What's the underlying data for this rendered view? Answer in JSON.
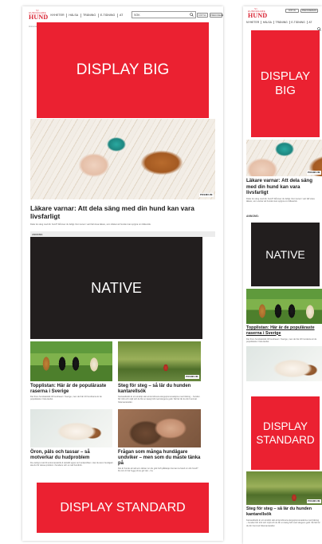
{
  "brand": {
    "small": "VI HUNDÄGARE",
    "big": "HUND"
  },
  "colors": {
    "accent": "#d81e2e",
    "ad_red": "#eb2131",
    "ad_black": "#221e1e"
  },
  "desktop": {
    "nav": [
      "NYHETER",
      "HÄLSA",
      "TRÄNING",
      "E-TIDNING",
      "AT"
    ],
    "search_value": "SÖK",
    "buttons": {
      "subscribe": "KÖP NU",
      "login": "PRENUMERERA"
    },
    "sub_label": "Annons",
    "ad_big": "DISPLAY BIG",
    "main_article": {
      "title": "Läkare varnar: Att dela säng med din hund kan vara livsfarligt",
      "body": "Delar du säng med din hund? Då lever du farligt. Det menar i varit fall vissa läkare, som tidskar att hunden kan sprjpra om lidkesrisk.",
      "badge": "PREMIUM"
    },
    "annons_label": "ANNONS:",
    "ad_native": "NATIVE",
    "grid": [
      {
        "title": "Topplistan: Här är de populäraste raserna i Sverige",
        "body": "Det finns hundstatistik till hundraser i Sverige, men det här 20 hundrarna är de populäraste i hela landet.",
        "badge": ""
      },
      {
        "title": "Steg för steg – så lär du hunden kantarellsök",
        "body": "Kantarellsökt är ett utmärkt sätt att kombinera skogspromenaderna med träning – hunden blir trött och nöjd och du får en kasig fullt med skogens guld. Så här lär du din hund att hitta kantareller.",
        "badge": "PREMIUM"
      },
      {
        "title": "Öron, päls och tassar – så motverkar du hudproblem",
        "body": "De vanligt ut att bli extra kanslorik & särskilt upper av hundproblem. Har du även hundgarn ska du för dessa problem i hundens och en rad hundinfo.",
        "badge": ""
      },
      {
        "title": "Frågan som många hundägare undviker – men som du måste tänka på",
        "body": "Det är hunde att säl som tänker om du gick hoft påktekje inte kan ta hand om din hund? Du tror ör här bygg vili av gör det – ha.",
        "badge": ""
      }
    ],
    "ad_standard": "DISPLAY STANDARD"
  },
  "mobile": {
    "buttons": {
      "subscribe": "KÖP NU",
      "login": "PRENUMERERA"
    },
    "nav": [
      "NYHETER",
      "HÄLSA",
      "TRÄNING",
      "E-TIDNING",
      "AT"
    ],
    "ad_big": "DISPLAY BIG",
    "main_article": {
      "title": "Läkare varnar: Att dela säng med din hund kan vara livsfarligt",
      "body": "Delar du säng med din hund? Då lever du farligt. Det menar i vart fall vissa läkare, som varnar att hunden kan sprjpra om lidkesrisk.",
      "badge": "PREMIUM"
    },
    "annons_label": "ANNONS:",
    "ad_native": "NATIVE",
    "article2": {
      "title": "Topplistan: Här är de populäraste raserna i Sverige",
      "body": "Det finns hundstatistik till hundraser i Sverige, men de här 20 hundarna är de populäraste i hela landet."
    },
    "ad_standard": "DISPLAY STANDARD",
    "article3": {
      "title": "Steg för steg – så lär du hunden kantarellsök",
      "body": "Kantarellsökt är ett utmärkt sätt att kombinera skogspromenaderna med träning – hunden blir trött och nöjd och du får en kasig fullt med skogens guld. Så här lär du din hund att hitta kantareller.",
      "badge": "PREMIUM"
    }
  }
}
